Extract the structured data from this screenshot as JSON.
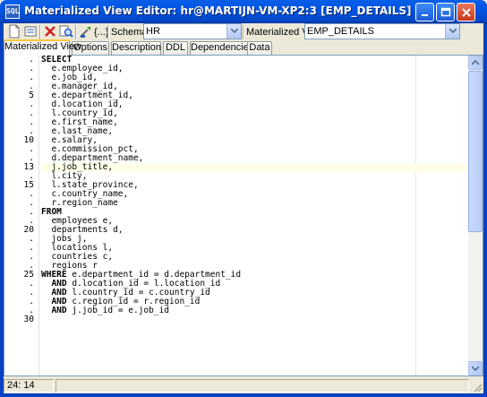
{
  "window": {
    "title": "Materialized View Editor: hr@MARTIJN-VM-XP2:3 [EMP_DETAILS]",
    "icon_text": "SQL"
  },
  "toolbar": {
    "schemas_label": "Schemas",
    "schemas_value": "HR",
    "mview_label": "Materialized View",
    "mview_value": "EMP_DETAILS",
    "macro_label": "{...}"
  },
  "tabs": [
    {
      "label": "Materialized View",
      "active": true
    },
    {
      "label": "Options",
      "active": false
    },
    {
      "label": "Description",
      "active": false
    },
    {
      "label": "DDL",
      "active": false
    },
    {
      "label": "Dependencies",
      "active": false
    },
    {
      "label": "Data",
      "active": false
    }
  ],
  "editor": {
    "current_line": 13,
    "lines": [
      {
        "num": ".",
        "text": "SELECT"
      },
      {
        "num": ".",
        "text": "  e.employee_id,"
      },
      {
        "num": ".",
        "text": "  e.job_id,"
      },
      {
        "num": ".",
        "text": "  e.manager_id,"
      },
      {
        "num": "5",
        "text": "  e.department_id,"
      },
      {
        "num": ".",
        "text": "  d.location_id,"
      },
      {
        "num": ".",
        "text": "  l.country_id,"
      },
      {
        "num": ".",
        "text": "  e.first_name,"
      },
      {
        "num": ".",
        "text": "  e.last_name,"
      },
      {
        "num": "10",
        "text": "  e.salary,"
      },
      {
        "num": ".",
        "text": "  e.commission_pct,"
      },
      {
        "num": ".",
        "text": "  d.department_name,"
      },
      {
        "num": "13",
        "text": "  j.job_title,"
      },
      {
        "num": ".",
        "text": "  l.city,"
      },
      {
        "num": "15",
        "text": "  l.state_province,"
      },
      {
        "num": ".",
        "text": "  c.country_name,"
      },
      {
        "num": ".",
        "text": "  r.region_name"
      },
      {
        "num": ".",
        "text": "FROM"
      },
      {
        "num": ".",
        "text": "  employees e,"
      },
      {
        "num": "20",
        "text": "  departments d,"
      },
      {
        "num": ".",
        "text": "  jobs j,"
      },
      {
        "num": ".",
        "text": "  locations l,"
      },
      {
        "num": ".",
        "text": "  countries c,"
      },
      {
        "num": ".",
        "text": "  regions r"
      },
      {
        "num": "25",
        "text": "WHERE e.department_id = d.department_id"
      },
      {
        "num": ".",
        "text": "  AND d.location_id = l.location_id"
      },
      {
        "num": ".",
        "text": "  AND l.country_id = c.country_id"
      },
      {
        "num": ".",
        "text": "  AND c.region_id = r.region_id"
      },
      {
        "num": ".",
        "text": "  AND j.job_id = e.job_id"
      },
      {
        "num": "30",
        "text": ""
      }
    ]
  },
  "status": {
    "position": "24: 14"
  },
  "icons": {
    "new": "new-document-icon",
    "open": "open-icon",
    "delete": "delete-icon",
    "find": "find-icon",
    "compile": "compile-icon"
  }
}
